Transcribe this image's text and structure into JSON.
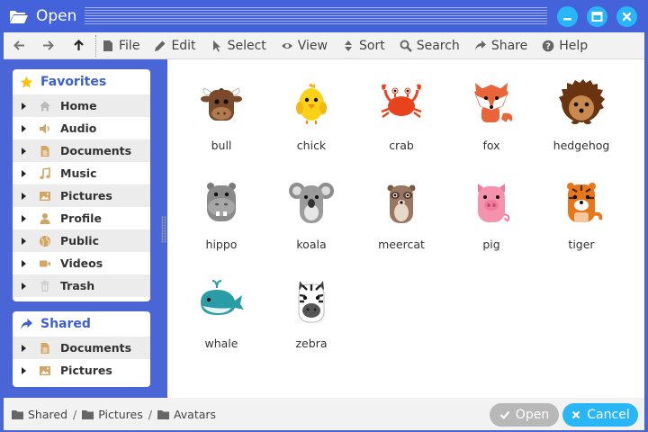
{
  "window": {
    "title": "Open"
  },
  "toolbar": {
    "menus": [
      {
        "id": "file",
        "label": "File"
      },
      {
        "id": "edit",
        "label": "Edit"
      },
      {
        "id": "select",
        "label": "Select"
      },
      {
        "id": "view",
        "label": "View"
      },
      {
        "id": "sort",
        "label": "Sort"
      },
      {
        "id": "search",
        "label": "Search"
      },
      {
        "id": "share",
        "label": "Share"
      },
      {
        "id": "help",
        "label": "Help"
      }
    ]
  },
  "sidebar": {
    "favorites": {
      "title": "Favorites",
      "items": [
        {
          "label": "Home",
          "icon": "home-icon"
        },
        {
          "label": "Audio",
          "icon": "speaker-icon"
        },
        {
          "label": "Documents",
          "icon": "document-icon"
        },
        {
          "label": "Music",
          "icon": "music-note-icon"
        },
        {
          "label": "Pictures",
          "icon": "picture-icon"
        },
        {
          "label": "Profile",
          "icon": "user-icon"
        },
        {
          "label": "Public",
          "icon": "globe-icon"
        },
        {
          "label": "Videos",
          "icon": "video-camera-icon"
        },
        {
          "label": "Trash",
          "icon": "trash-icon"
        }
      ]
    },
    "shared": {
      "title": "Shared",
      "items": [
        {
          "label": "Documents",
          "icon": "document-icon"
        },
        {
          "label": "Pictures",
          "icon": "picture-icon"
        }
      ]
    }
  },
  "files": [
    {
      "name": "bull",
      "icon": "bull-avatar-icon"
    },
    {
      "name": "chick",
      "icon": "chick-avatar-icon"
    },
    {
      "name": "crab",
      "icon": "crab-avatar-icon"
    },
    {
      "name": "fox",
      "icon": "fox-avatar-icon"
    },
    {
      "name": "hedgehog",
      "icon": "hedgehog-avatar-icon"
    },
    {
      "name": "hippo",
      "icon": "hippo-avatar-icon"
    },
    {
      "name": "koala",
      "icon": "koala-avatar-icon"
    },
    {
      "name": "meercat",
      "icon": "meercat-avatar-icon"
    },
    {
      "name": "pig",
      "icon": "pig-avatar-icon"
    },
    {
      "name": "tiger",
      "icon": "tiger-avatar-icon"
    },
    {
      "name": "whale",
      "icon": "whale-avatar-icon"
    },
    {
      "name": "zebra",
      "icon": "zebra-avatar-icon"
    }
  ],
  "breadcrumb": [
    "Shared",
    "Pictures",
    "Avatars"
  ],
  "buttons": {
    "open": "Open",
    "cancel": "Cancel"
  },
  "colors": {
    "accent": "#4463db",
    "window_button": "#29b6f6",
    "open_button": "#b8b8b8",
    "cancel_button": "#29b6f6",
    "favorites_star": "#ffc107",
    "folder_icon": "#d4a463"
  }
}
